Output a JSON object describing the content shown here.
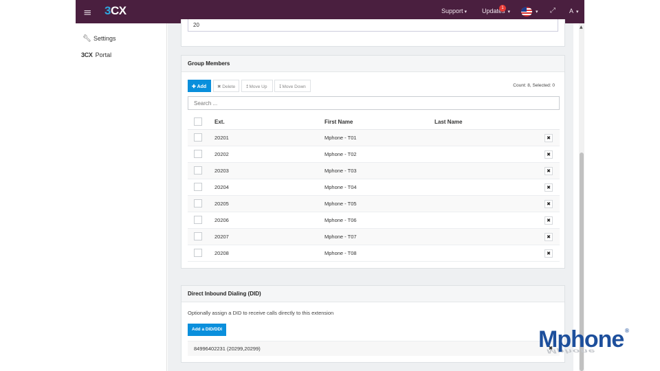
{
  "topbar": {
    "logo": "3CX",
    "menu_icon": "hamburger-icon",
    "support_label": "Support",
    "updates_label": "Updates",
    "updates_badge": "1",
    "language_icon": "us-flag-icon",
    "expand_icon": "expand-icon",
    "user_label": "A",
    "bg_color": "#4a1f3f"
  },
  "sidebar": {
    "items": [
      {
        "label": "Settings",
        "icon": "wrench-icon"
      },
      {
        "label": "Portal",
        "icon": "3cx-logo-icon",
        "prefix": "3CX"
      }
    ]
  },
  "previous_field": {
    "value": "20"
  },
  "group_members": {
    "title": "Group Members",
    "add_label": "Add",
    "delete_label": "Delete",
    "move_up_label": "Move Up",
    "move_down_label": "Move Down",
    "count_text": "Count: 8, Selected: 0",
    "search_placeholder": "Search ...",
    "columns": [
      "Ext.",
      "First Name",
      "Last Name"
    ],
    "rows": [
      {
        "ext": "20201",
        "first": "Mphone - T01",
        "last": ""
      },
      {
        "ext": "20202",
        "first": "Mphone - T02",
        "last": ""
      },
      {
        "ext": "20203",
        "first": "Mphone - T03",
        "last": ""
      },
      {
        "ext": "20204",
        "first": "Mphone - T04",
        "last": ""
      },
      {
        "ext": "20205",
        "first": "Mphone - T05",
        "last": ""
      },
      {
        "ext": "20206",
        "first": "Mphone - T06",
        "last": ""
      },
      {
        "ext": "20207",
        "first": "Mphone - T07",
        "last": ""
      },
      {
        "ext": "20208",
        "first": "Mphone - T08",
        "last": ""
      }
    ]
  },
  "did": {
    "title": "Direct Inbound Dialing (DID)",
    "description": "Optionally assign a DID to receive calls directly to this extension",
    "add_label": "Add a DID/DDI",
    "entries": [
      "84996402231 (20299,20299)"
    ]
  },
  "watermark": {
    "text": "Mphone",
    "registered": "®"
  },
  "colors": {
    "accent": "#0a8fdc",
    "brand": "#4a1f3f",
    "watermark": "#1d4f9c"
  }
}
